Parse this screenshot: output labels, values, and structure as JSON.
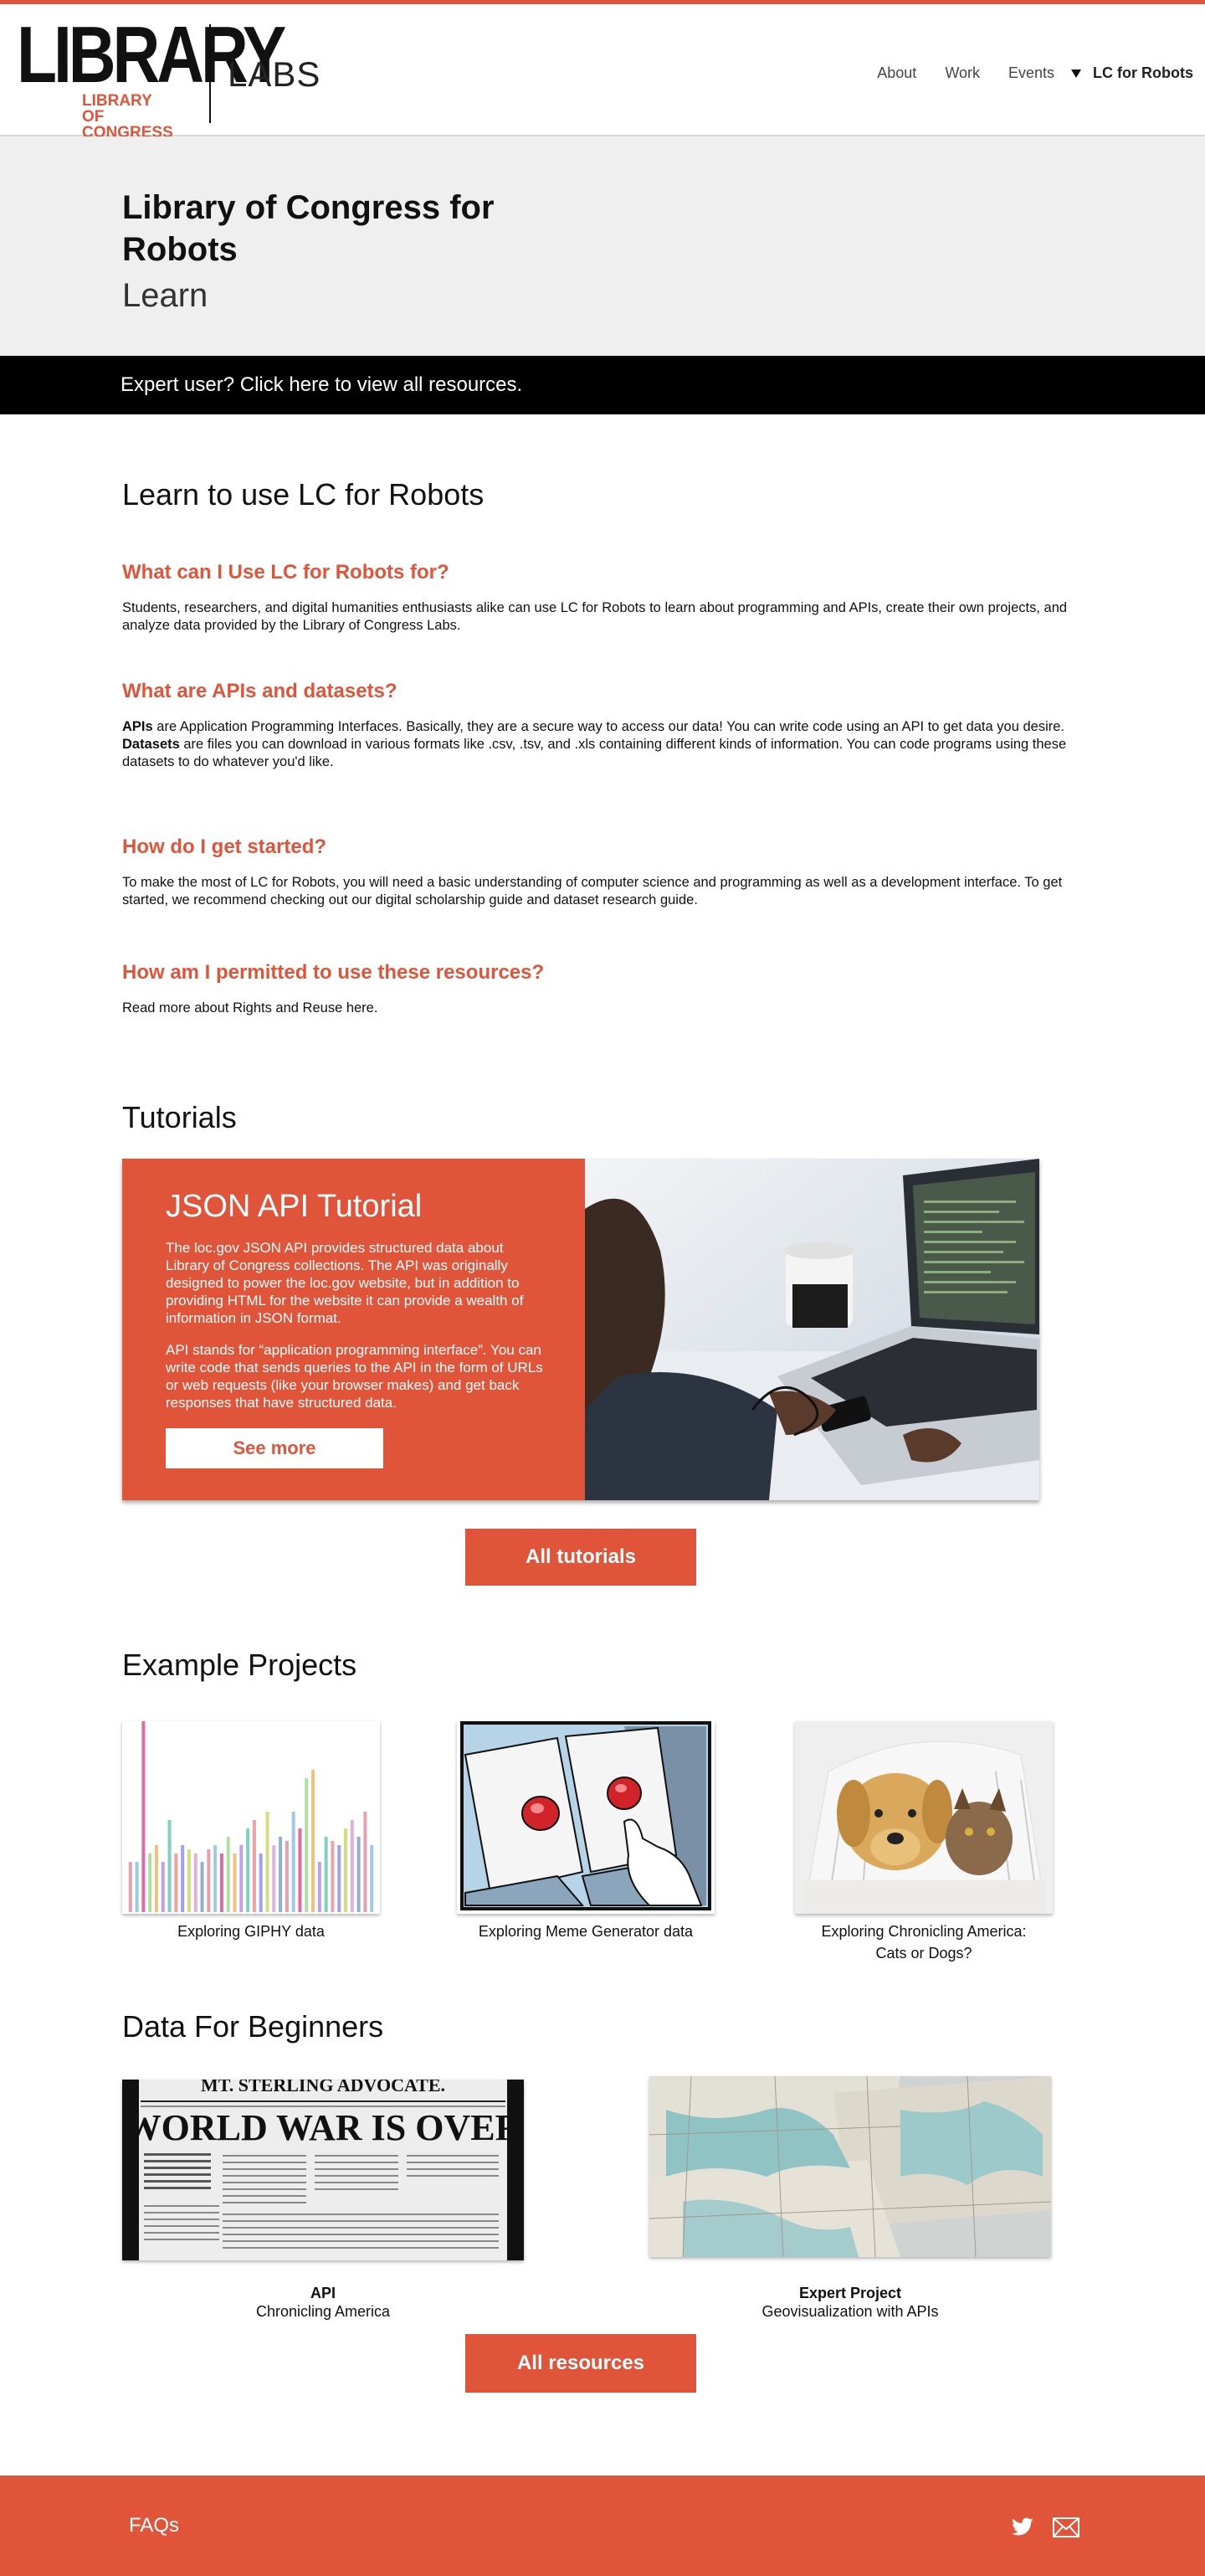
{
  "header": {
    "logo_word": "LIBRARY",
    "logo_sub_1": "LIBRARY",
    "logo_sub_2": "OF CONGRESS",
    "labs": "LABS",
    "nav": [
      "About",
      "Work",
      "Events",
      "LC for Robots"
    ]
  },
  "hero": {
    "title": "Library of Congress for Robots",
    "subtitle": "Learn"
  },
  "expert_bar": "Expert user? Click here to view all resources.",
  "learn": {
    "heading": "Learn to use LC for Robots",
    "faq": [
      {
        "q": "What can I Use LC for Robots for?",
        "a": "Students, researchers, and digital humanities enthusiasts alike can use LC for Robots to learn about programming and APIs, create their own projects, and analyze data provided by the Library of Congress Labs."
      },
      {
        "q": "What are APIs and datasets?",
        "a1_bold": "APIs",
        "a1": " are Application Programming Interfaces. Basically, they are a secure way to access our data! You can write code using an API to get data you desire.",
        "a2_bold": "Datasets",
        "a2": " are files you can download in various formats like .csv, .tsv, and .xls containing different kinds of information. You can code programs using these datasets to do whatever you'd like."
      },
      {
        "q": "How do I get started?",
        "a": "To make the most of LC for Robots, you will need a basic understanding of computer science and programming as well as a development interface. To get started, we recommend checking out our digital scholarship guide and dataset research guide."
      },
      {
        "q": "How am I permitted to use these resources?",
        "a": "Read more about Rights and Reuse here."
      }
    ]
  },
  "tutorials": {
    "heading": "Tutorials",
    "card_title": "JSON API Tutorial",
    "p1": "The loc.gov JSON API provides structured data about Library of Congress collections. The API was originally designed to power the loc.gov website, but in addition to providing HTML for the website it can provide a wealth of information in JSON format.",
    "p2": "API stands for “application programming interface”. You can write code that sends queries to the API in the form of URLs or web requests (like your browser makes) and get back responses that have structured data.",
    "see_more": "See more",
    "all_tutorials": "All tutorials"
  },
  "projects": {
    "heading": "Example Projects",
    "items": [
      {
        "caption": "Exploring GIPHY data"
      },
      {
        "caption": "Exploring Meme Generator data"
      },
      {
        "caption_1": "Exploring Chronicling America:",
        "caption_2": "Cats or Dogs?"
      }
    ]
  },
  "beginners": {
    "heading": "Data For Beginners",
    "newspaper_headline": "WORLD WAR IS OVER",
    "newspaper_masthead": "MT. STERLING ADVOCATE.",
    "items": [
      {
        "type": "API",
        "name": "Chronicling America"
      },
      {
        "type": "Expert Project",
        "name": "Geovisualization with APIs"
      }
    ],
    "all_resources": "All resources"
  },
  "footer": {
    "faqs": "FAQs"
  },
  "colors": {
    "accent": "#e0553a",
    "black": "#000000",
    "hero_bg": "#efefef"
  }
}
